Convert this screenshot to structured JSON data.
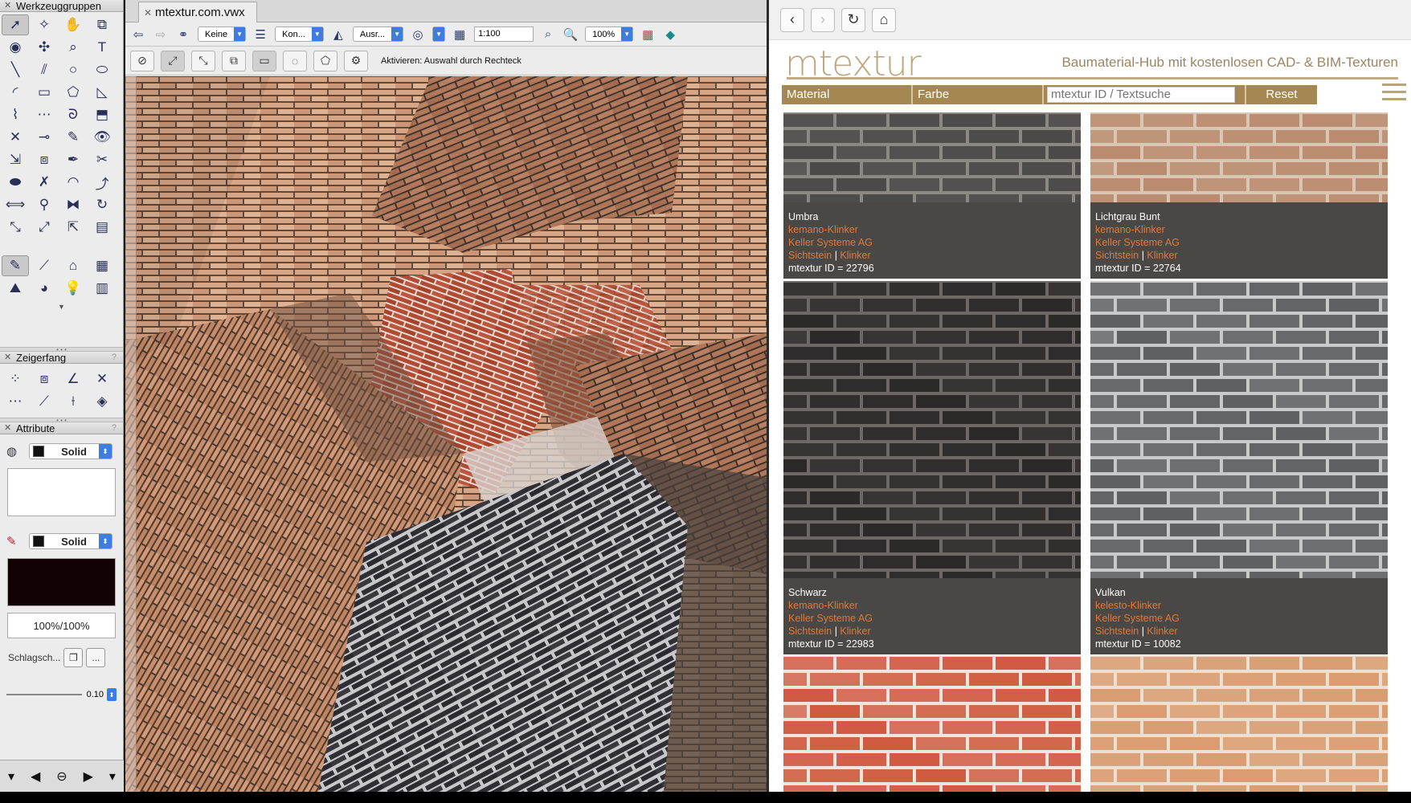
{
  "palettes": {
    "tools": {
      "title": "Werkzeuggruppen"
    },
    "snap": {
      "title": "Zeigerfang"
    },
    "attributes": {
      "title": "Attribute",
      "fill_style": "Solid",
      "pen_style": "Solid",
      "opacity": "100%/100%",
      "shadow_label": "Schlagsch...",
      "shadow_more": "...",
      "line_weight": "0.10"
    }
  },
  "doc": {
    "tab_title": "mtextur.com.vwx",
    "class_value": "Keine",
    "layer_value": "Kon...",
    "view_value": "Ausr...",
    "scale_value": "1:100",
    "zoom_value": "100%",
    "mode_hint": "Aktivieren: Auswahl durch Rechteck"
  },
  "browser": {
    "logo": "mtextur",
    "tagline": "Baumaterial-Hub mit kostenlosen CAD- & BIM-Texturen",
    "nav": {
      "material": "Material",
      "farbe": "Farbe",
      "search_placeholder": "mtextur ID / Textsuche",
      "reset": "Reset"
    },
    "cards": [
      {
        "name": "Umbra",
        "product": "kemano-Klinker",
        "company": "Keller Systeme AG",
        "cat1": "Sichtstein",
        "sep": "|",
        "cat2": "Klinker",
        "id": "mtextur ID = 22796",
        "brick": "#4a4747",
        "mortar": "#8c8884"
      },
      {
        "name": "Lichtgrau Bunt",
        "product": "kemano-Klinker",
        "company": "Keller Systeme AG",
        "cat1": "Sichtstein",
        "sep": "|",
        "cat2": "Klinker",
        "id": "mtextur ID = 22764",
        "brick": "#b98a6c",
        "mortar": "#d9c6b4"
      },
      {
        "name": "Schwarz",
        "product": "kemano-Klinker",
        "company": "Keller Systeme AG",
        "cat1": "Sichtstein",
        "sep": "|",
        "cat2": "Klinker",
        "id": "mtextur ID = 22983",
        "brick": "#2b2828",
        "mortar": "#6d6865"
      },
      {
        "name": "Vulkan",
        "product": "kelesto-Klinker",
        "company": "Keller Systeme AG",
        "cat1": "Sichtstein",
        "sep": "|",
        "cat2": "Klinker",
        "id": "mtextur ID = 10082",
        "brick": "#5c5e62",
        "mortar": "#c9c9c9"
      },
      {
        "brick": "#d0573e",
        "mortar": "#eee6de"
      },
      {
        "brick": "#d99a6e",
        "mortar": "#ece0d2"
      }
    ]
  }
}
